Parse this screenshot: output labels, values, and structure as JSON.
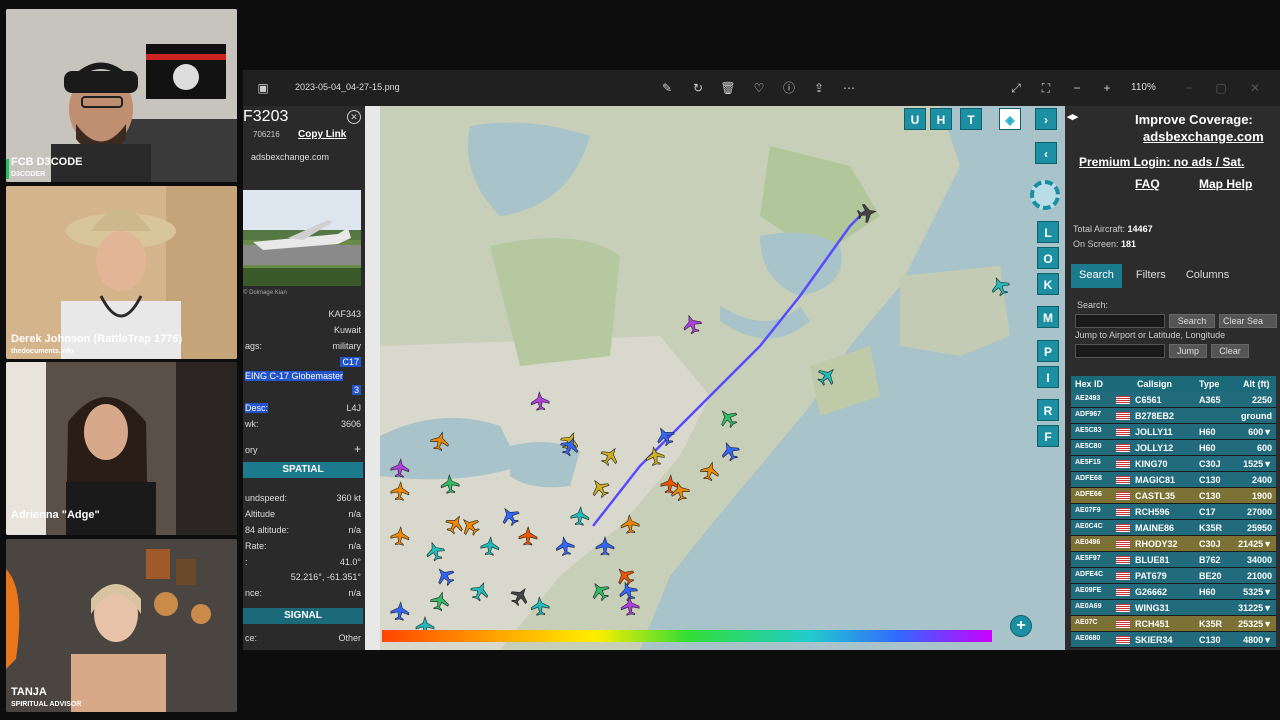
{
  "participants": [
    {
      "name": "FCB D3CODE",
      "sub": "D3CODER"
    },
    {
      "name": "Derek Johnson (RattleTrap 1776)",
      "sub": "thedocuments.info"
    },
    {
      "name": "Adrienna \"Adge\"",
      "sub": ""
    },
    {
      "name": "TANJA",
      "sub": "SPIRITUAL ADVISOR"
    }
  ],
  "viewer": {
    "filename": "2023-05-04_04-27-15.png",
    "zoom": "110%"
  },
  "aircraft": {
    "callsign_header": "F3203",
    "hex": "706216",
    "copy_link": "Copy Link",
    "site": "adsbexchange.com",
    "photo_credit": "© Dolmage Kian",
    "reg": "KAF343",
    "country": "Kuwait",
    "flags_label": "ags:",
    "flags_value": "military",
    "type_code": "C17",
    "type_name": "EING C-17 Globemaster",
    "type_num": "3",
    "desc_label": "Desc:",
    "desc_value": "L4J",
    "owk_label": "wk:",
    "owk_value": "3606",
    "history_label": "ory",
    "spatial_label": "SPATIAL",
    "groundspeed_label": "undspeed:",
    "groundspeed_value": "360 kt",
    "altitude_label": "Altitude",
    "altitude_value": "n/a",
    "wgs_label": "84 altitude:",
    "wgs_value": "n/a",
    "rate_label": "Rate:",
    "rate_value": "n/a",
    "track_label": ":",
    "track_value": "41.0°",
    "pos_value": "52.216°, -61.351°",
    "dist_label": "nce:",
    "dist_value": "n/a",
    "signal_label": "SIGNAL",
    "source_label": "ce:",
    "source_value": "Other"
  },
  "map_buttons": {
    "top": [
      "U",
      "H",
      "T"
    ],
    "side": [
      "L",
      "O",
      "K",
      "M",
      "P",
      "I",
      "R",
      "F"
    ],
    "zoom_in": "+"
  },
  "right_panel": {
    "improve": "Improve Coverage:",
    "site": "adsbexchange.com",
    "premium": "Premium Login: no ads / Sat.",
    "faq": "FAQ",
    "map_help": "Map Help",
    "total_label": "Total Aircraft:",
    "total_value": "14467",
    "onscreen_label": "On Screen:",
    "onscreen_value": "181",
    "tabs": [
      "Search",
      "Filters",
      "Columns"
    ],
    "search_label": "Search:",
    "search_btn": "Search",
    "clear_btn": "Clear Sea",
    "jump_label": "Jump to Airport or Latitude, Longitude",
    "jump_btn": "Jump",
    "clear2_btn": "Clear",
    "columns": [
      "Hex ID",
      "Callsign",
      "Type",
      "Alt (ft)"
    ],
    "rows": [
      {
        "hex": "AE2493",
        "call": "C6561",
        "type": "A365",
        "alt": "2250",
        "mil": false
      },
      {
        "hex": "ADF967",
        "call": "B278EB2",
        "type": "",
        "alt": "ground",
        "mil": false
      },
      {
        "hex": "AE5C83",
        "call": "JOLLY11",
        "type": "H60",
        "alt": "600▼",
        "mil": false
      },
      {
        "hex": "AE5C80",
        "call": "JOLLY12",
        "type": "H60",
        "alt": "600",
        "mil": false
      },
      {
        "hex": "AE5F15",
        "call": "KING70",
        "type": "C30J",
        "alt": "1525▼",
        "mil": false
      },
      {
        "hex": "ADFE68",
        "call": "MAGIC81",
        "type": "C130",
        "alt": "2400",
        "mil": false
      },
      {
        "hex": "ADFE66",
        "call": "CASTL35",
        "type": "C130",
        "alt": "1900",
        "mil": true
      },
      {
        "hex": "AE07F9",
        "call": "RCH596",
        "type": "C17",
        "alt": "27000",
        "mil": false
      },
      {
        "hex": "AE0C4C",
        "call": "MAINE86",
        "type": "K35R",
        "alt": "25950",
        "mil": false
      },
      {
        "hex": "AE0496",
        "call": "RHODY32",
        "type": "C30J",
        "alt": "21425▼",
        "mil": true
      },
      {
        "hex": "AE5F97",
        "call": "BLUE81",
        "type": "B762",
        "alt": "34000",
        "mil": false
      },
      {
        "hex": "ADFE4C",
        "call": "PAT679",
        "type": "BE20",
        "alt": "21000",
        "mil": false
      },
      {
        "hex": "AE09FE",
        "call": "G26662",
        "type": "H60",
        "alt": "5325▼",
        "mil": false
      },
      {
        "hex": "AE0A69",
        "call": "WING31",
        "type": "",
        "alt": "31225▼",
        "mil": false
      },
      {
        "hex": "AE07C",
        "call": "RCH451",
        "type": "K35R",
        "alt": "25325▼",
        "mil": true
      },
      {
        "hex": "AE0680",
        "call": "SKIER34",
        "type": "C130",
        "alt": "4800▼",
        "mil": false
      }
    ]
  },
  "colors": {
    "teal_button": "#1d8fa3",
    "section_bg": "#1b7a8c",
    "track_line": "#5a4bff",
    "row_mil": "#7d7235",
    "row_normal": "#226b7d"
  }
}
